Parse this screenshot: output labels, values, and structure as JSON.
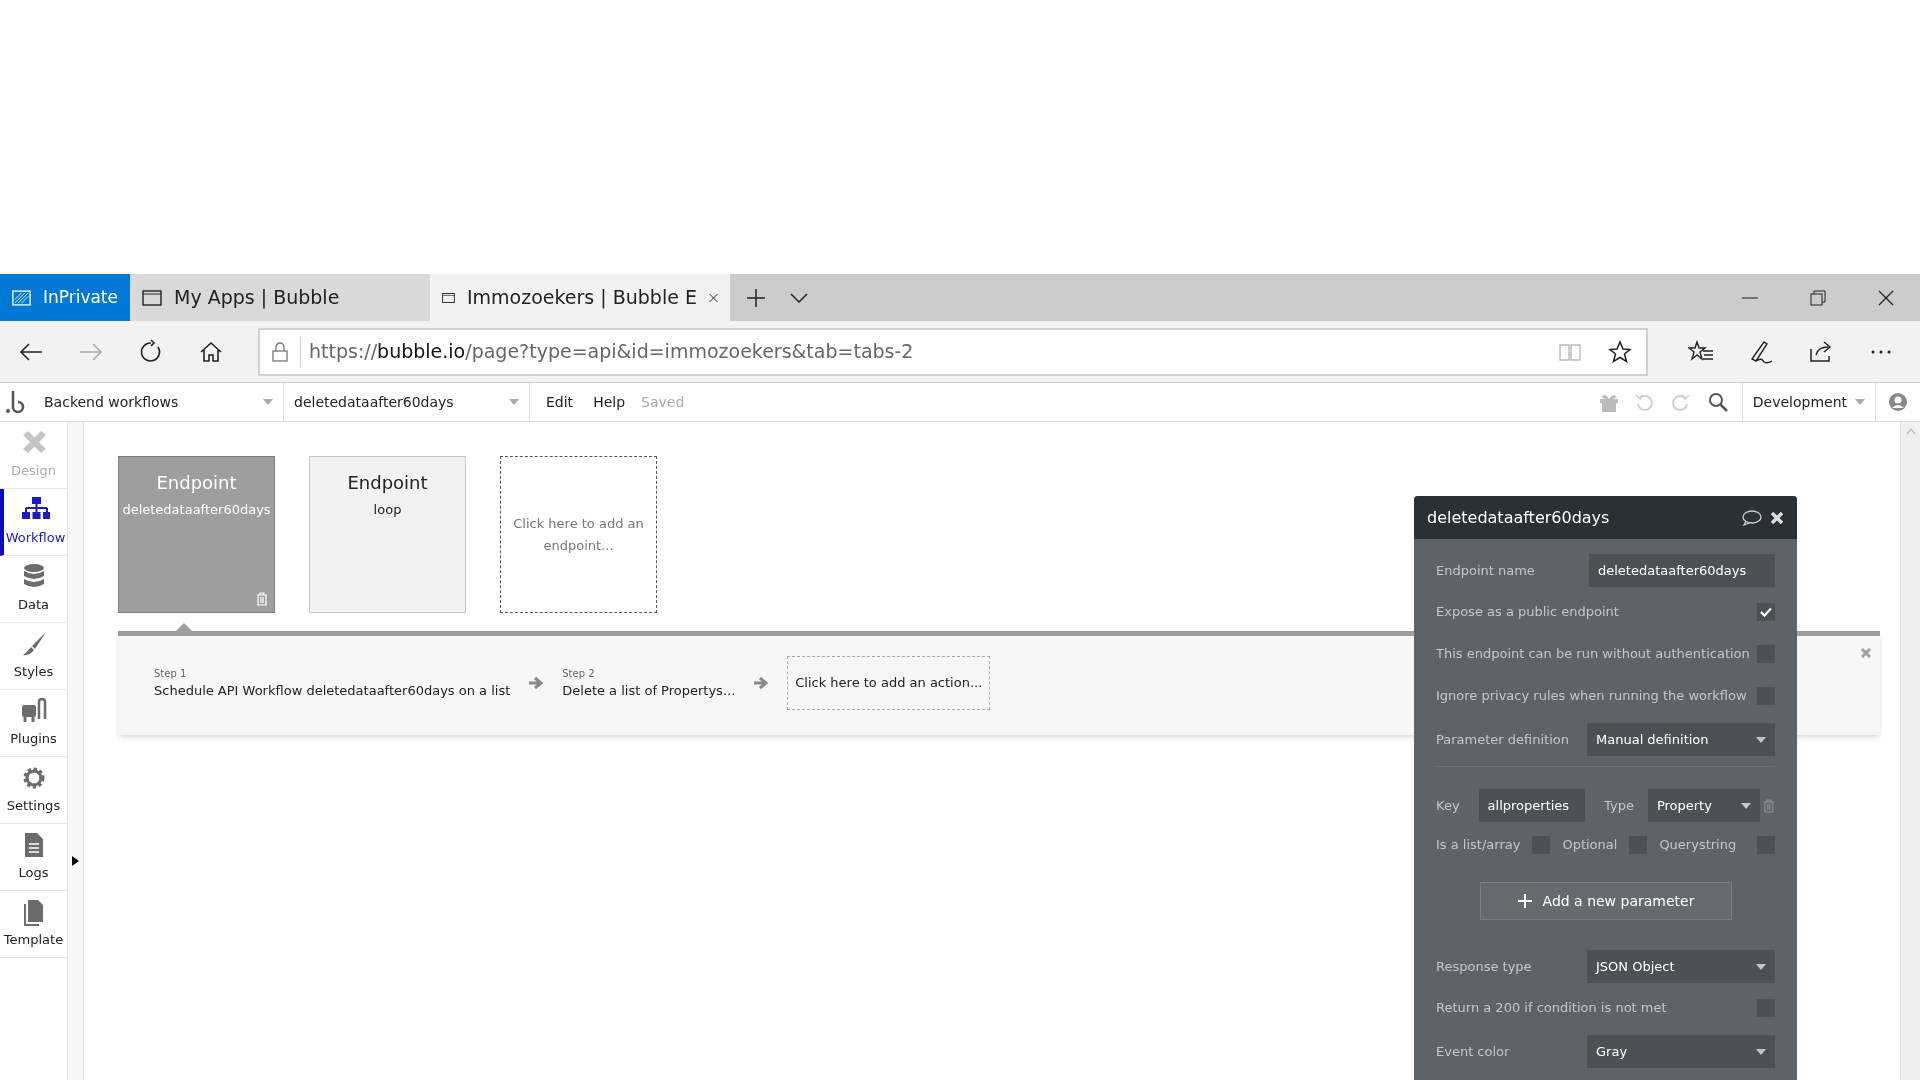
{
  "browser": {
    "private_label": "InPrivate",
    "tabs": [
      {
        "title": "My Apps | Bubble",
        "selected": false
      },
      {
        "title": "Immozoekers | Bubble E",
        "selected": true
      }
    ],
    "url_host": "https://bubble.io",
    "url_path": "/page?type=api&id=immozoekers&tab=tabs-2"
  },
  "toolbar": {
    "page": "Backend workflows",
    "workflow": "deletedataafter60days",
    "menus": [
      "Edit",
      "Help"
    ],
    "status": "Saved",
    "version": "Development"
  },
  "sidebar": [
    {
      "label": "Design",
      "kind": "design",
      "selected": false,
      "disabled": true
    },
    {
      "label": "Workflow",
      "kind": "workflow",
      "selected": true,
      "disabled": false
    },
    {
      "label": "Data",
      "kind": "data",
      "selected": false,
      "disabled": false
    },
    {
      "label": "Styles",
      "kind": "styles",
      "selected": false,
      "disabled": false
    },
    {
      "label": "Plugins",
      "kind": "plugins",
      "selected": false,
      "disabled": false
    },
    {
      "label": "Settings",
      "kind": "settings",
      "selected": false,
      "disabled": false
    },
    {
      "label": "Logs",
      "kind": "logs",
      "selected": false,
      "disabled": false
    },
    {
      "label": "Template",
      "kind": "template",
      "selected": false,
      "disabled": false
    }
  ],
  "endpoints": [
    {
      "kind": "endpoint",
      "title": "Endpoint",
      "name": "deletedataafter60days",
      "selected": true
    },
    {
      "kind": "endpoint",
      "title": "Endpoint",
      "name": "loop",
      "selected": false
    },
    {
      "kind": "add",
      "text": "Click here to add an endpoint..."
    }
  ],
  "steps": [
    {
      "kind": "step",
      "label": "Step 1",
      "text": "Schedule API Workflow deletedataafter60days on a list"
    },
    {
      "kind": "step",
      "label": "Step 2",
      "text": "Delete a list of Propertys..."
    },
    {
      "kind": "add",
      "text": "Click here to add an action..."
    }
  ],
  "panel": {
    "title": "deletedataafter60days",
    "rows": [
      {
        "kind": "field",
        "label": "Endpoint name",
        "value": "deletedataafter60days"
      },
      {
        "kind": "checkbox",
        "label": "Expose as a public endpoint",
        "checked": true
      },
      {
        "kind": "checkbox",
        "label": "This endpoint can be run without authentication",
        "checked": false
      },
      {
        "kind": "checkbox",
        "label": "Ignore privacy rules when running the workflow",
        "checked": false
      },
      {
        "kind": "dropdown",
        "label": "Parameter definition",
        "value": "Manual definition"
      },
      {
        "kind": "parameter",
        "key_label": "Key",
        "key_value": "allproperties",
        "type_label": "Type",
        "type_value": "Property",
        "flags": [
          {
            "label": "Is a list/array",
            "checked": false
          },
          {
            "label": "Optional",
            "checked": false
          },
          {
            "label": "Querystring",
            "checked": false
          }
        ]
      },
      {
        "kind": "button",
        "label": "Add a new parameter"
      },
      {
        "kind": "dropdown",
        "label": "Response type",
        "value": "JSON Object"
      },
      {
        "kind": "checkbox",
        "label": "Return a 200 if condition is not met",
        "checked": false
      },
      {
        "kind": "dropdown",
        "label": "Event color",
        "value": "Gray"
      }
    ]
  }
}
